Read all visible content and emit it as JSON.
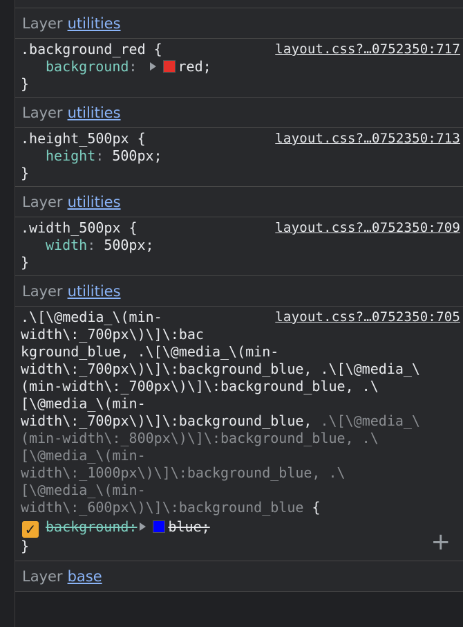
{
  "blocks": [
    {
      "layer_label": "Layer",
      "layer_name": "utilities",
      "source": "layout.css?…0752350:717",
      "selector": ".background_red {",
      "prop": "background",
      "value": "red;",
      "swatch_color": "#e5302a"
    },
    {
      "layer_label": "Layer",
      "layer_name": "utilities",
      "source": "layout.css?…0752350:713",
      "selector": ".height_500px {",
      "prop": "height",
      "value": "500px;"
    },
    {
      "layer_label": "Layer",
      "layer_name": "utilities",
      "source": "layout.css?…0752350:709",
      "selector": ".width_500px {",
      "prop": "width",
      "value": "500px;"
    },
    {
      "layer_label": "Layer",
      "layer_name": "utilities",
      "source": "layout.css?…0752350:705",
      "selector_lines": [
        ".\\[\\@media_\\(min-",
        "width\\:_700px\\)\\]\\:bac",
        "kground_blue, .\\[\\@media_\\(min-",
        "width\\:_700px\\)\\]\\:background_blue, .\\[\\@media_\\",
        "(min-width\\:_700px\\)\\]\\:background_blue, .\\",
        "[\\@media_\\(min-",
        "width\\:_700px\\)\\]\\:background_blue, ",
        "(min-width\\:_800px\\)\\]\\:background_blue, .\\",
        "[\\@media_\\(min-",
        "width\\:_1000px\\)\\]\\:background_blue, .\\",
        "[\\@media_\\(min-",
        "width\\:_600px\\)\\]\\:background_blue "
      ],
      "selector_tail_grey": ".\\[\\@media_\\",
      "open_brace": "{",
      "prop": "background",
      "value": "blue;",
      "swatch_color": "#0000ff",
      "checkbox_mark": "✓",
      "add_glyph": "+"
    },
    {
      "layer_label": "Layer",
      "layer_name": "base"
    }
  ],
  "punct": {
    "colon": ":",
    "close_brace": "}"
  }
}
